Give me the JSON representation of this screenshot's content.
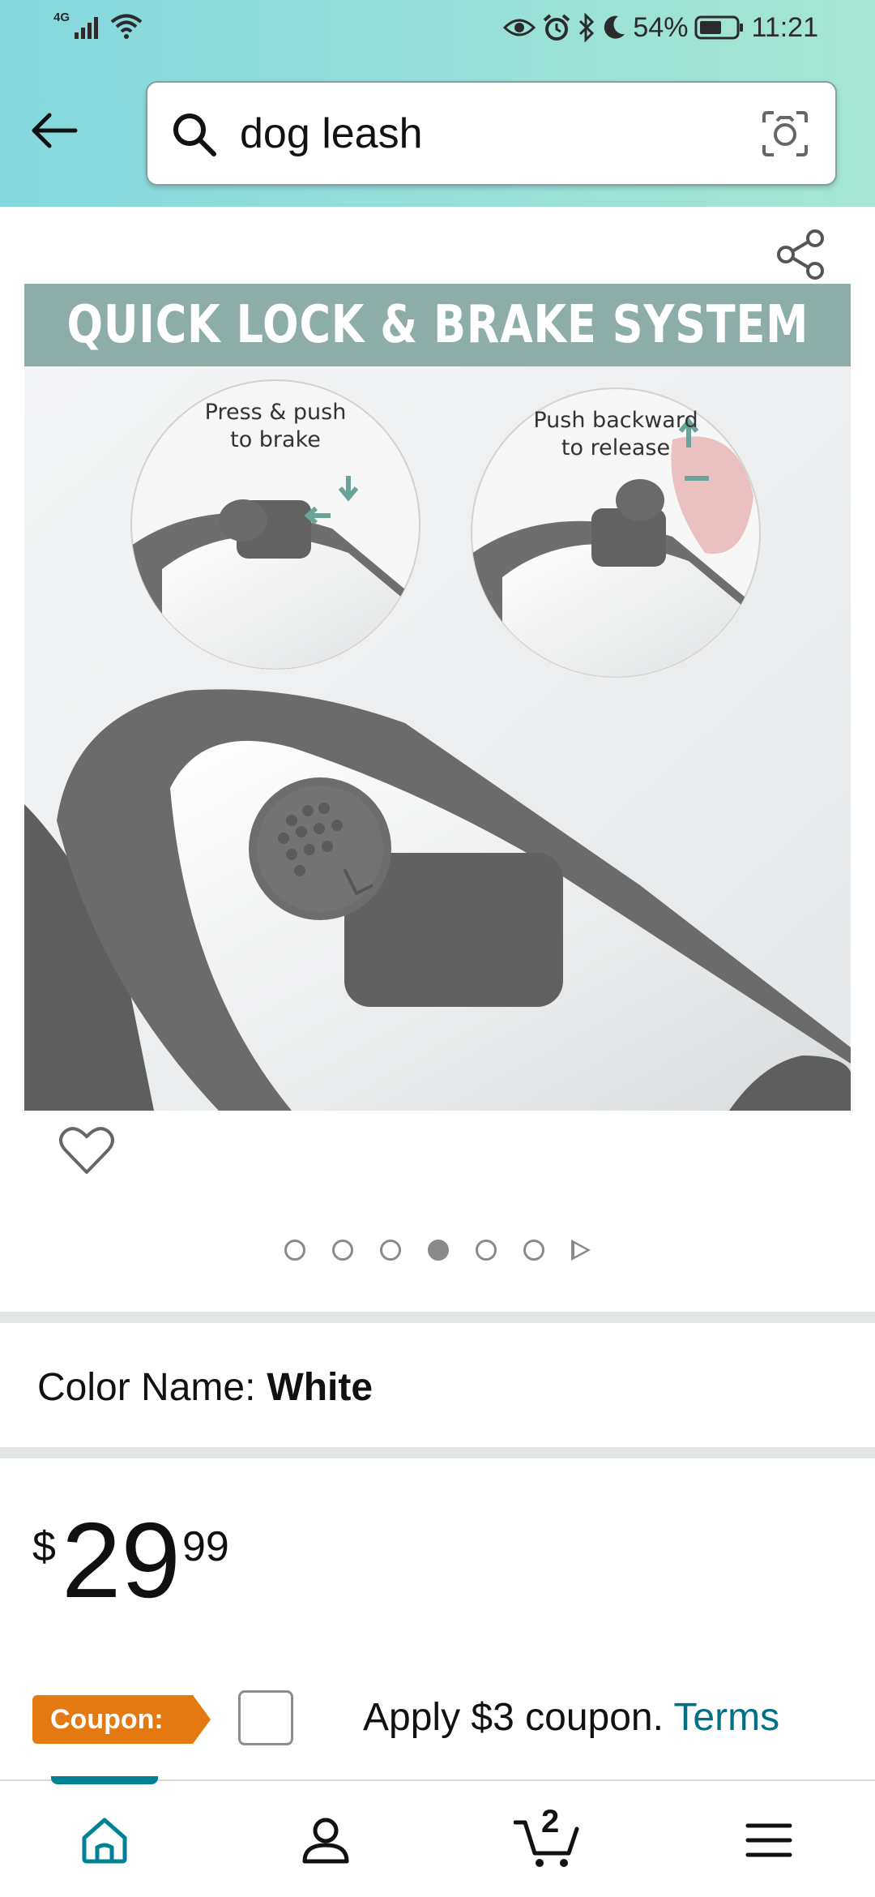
{
  "status_bar": {
    "network": "4G",
    "battery": "54%",
    "time": "11:21"
  },
  "search": {
    "query": "dog leash"
  },
  "product_image": {
    "banner": "QUICK LOCK & BRAKE SYSTEM",
    "callout_left_line1": "Press & push",
    "callout_left_line2": "to brake",
    "callout_right_line1": "Push backward",
    "callout_right_line2": "to release"
  },
  "carousel": {
    "dots": 6,
    "active_index": 3
  },
  "variation": {
    "label": "Color Name:",
    "value": "White"
  },
  "price": {
    "symbol": "$",
    "whole": "29",
    "fraction": "99"
  },
  "coupon": {
    "badge": "Coupon:",
    "text": "Apply $3 coupon.",
    "link": "Terms"
  },
  "bottom_nav": {
    "cart_count": "2",
    "items": [
      "home-icon",
      "account-icon",
      "cart-icon",
      "menu-icon"
    ]
  },
  "colors": {
    "header_start": "#84d8dd",
    "header_end": "#a6e6d2",
    "coupon_orange": "#e47911",
    "link_teal": "#007185",
    "nav_active": "#008296"
  }
}
